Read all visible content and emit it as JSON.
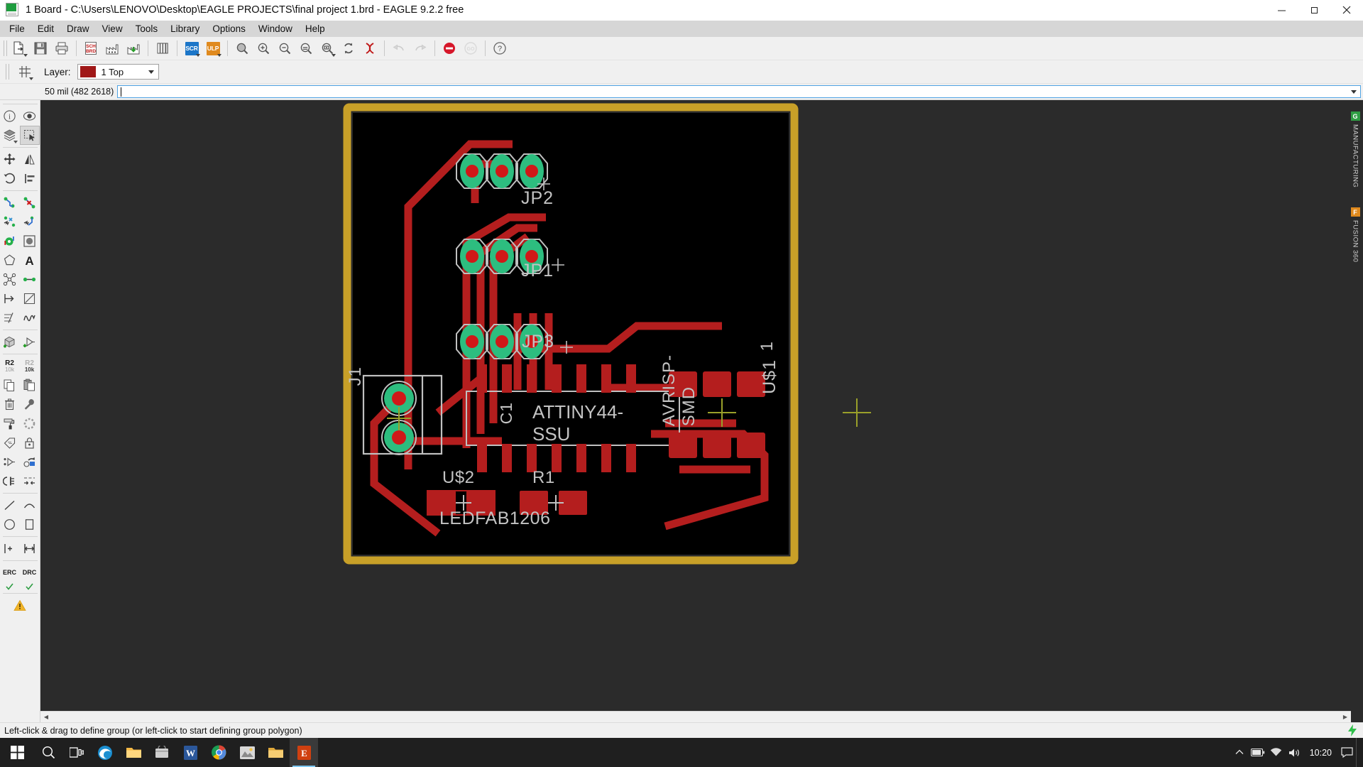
{
  "window": {
    "title": "1 Board - C:\\Users\\LENOVO\\Desktop\\EAGLE PROJECTS\\final project 1.brd - EAGLE 9.2.2 free",
    "app_icon": "brd-file-icon",
    "minimize_label": "Minimize",
    "maximize_label": "Restore",
    "close_label": "Close"
  },
  "menubar": {
    "items": [
      {
        "label": "File"
      },
      {
        "label": "Edit"
      },
      {
        "label": "Draw"
      },
      {
        "label": "View"
      },
      {
        "label": "Tools"
      },
      {
        "label": "Library"
      },
      {
        "label": "Options"
      },
      {
        "label": "Window"
      },
      {
        "label": "Help"
      }
    ]
  },
  "toolbar": {
    "buttons": [
      {
        "name": "open-file-button",
        "icon": "open-document-icon",
        "title": "Open",
        "dropdown": true,
        "disabled": false
      },
      {
        "name": "save-button",
        "icon": "floppy-save-icon",
        "title": "Save",
        "dropdown": false,
        "disabled": false
      },
      {
        "name": "print-button",
        "icon": "printer-icon",
        "title": "Print",
        "dropdown": false,
        "disabled": false
      },
      {
        "name": "switch-to-schematic-button",
        "icon": "sch-brd-switch-icon",
        "title": "Switch to Schematic",
        "dropdown": false,
        "disabled": false
      },
      {
        "name": "cam-processor-button",
        "icon": "factory-icon",
        "title": "CAM Processor",
        "dropdown": false,
        "disabled": false
      },
      {
        "name": "manufacturing-download-button",
        "icon": "factory-download-icon",
        "title": "Generate manufacturing data",
        "dropdown": false,
        "disabled": false
      },
      {
        "name": "library-manager-button",
        "icon": "books-icon",
        "title": "Library Manager",
        "dropdown": false,
        "disabled": false
      },
      {
        "name": "script-button",
        "icon": "scr-icon",
        "title": "Execute Script",
        "dropdown": true,
        "disabled": false,
        "badge": "SCR",
        "badge_color": "#1c76c8"
      },
      {
        "name": "ulp-button",
        "icon": "ulp-icon",
        "title": "Run ULP",
        "dropdown": true,
        "disabled": false,
        "badge": "ULP",
        "badge_color": "#e08a1e"
      },
      {
        "name": "zoom-fit-button",
        "icon": "zoom-fit-icon",
        "title": "Zoom to fit",
        "dropdown": false,
        "disabled": false
      },
      {
        "name": "zoom-in-button",
        "icon": "zoom-in-icon",
        "title": "Zoom in",
        "dropdown": false,
        "disabled": false
      },
      {
        "name": "zoom-out-button",
        "icon": "zoom-out-icon",
        "title": "Zoom out",
        "dropdown": false,
        "disabled": false
      },
      {
        "name": "zoom-previous-button",
        "icon": "zoom-previous-icon",
        "title": "Zoom previous",
        "dropdown": false,
        "disabled": false
      },
      {
        "name": "zoom-select-button",
        "icon": "zoom-select-icon",
        "title": "Zoom select",
        "dropdown": true,
        "disabled": false
      },
      {
        "name": "redraw-button",
        "icon": "refresh-icon",
        "title": "Redraw",
        "dropdown": false,
        "disabled": false
      },
      {
        "name": "autorouter-button",
        "icon": "ratsnest-x-icon",
        "title": "Ratsnest",
        "dropdown": false,
        "disabled": false
      },
      {
        "name": "undo-button",
        "icon": "undo-arrow-icon",
        "title": "Undo",
        "dropdown": false,
        "disabled": true
      },
      {
        "name": "redo-button",
        "icon": "redo-arrow-icon",
        "title": "Redo",
        "dropdown": false,
        "disabled": true
      },
      {
        "name": "stop-button",
        "icon": "stop-circle-icon",
        "title": "Stop",
        "dropdown": false,
        "disabled": false
      },
      {
        "name": "go-button",
        "icon": "go-circle-icon",
        "title": "Go",
        "dropdown": false,
        "disabled": true
      },
      {
        "name": "help-button",
        "icon": "question-mark-icon",
        "title": "Help",
        "dropdown": false,
        "disabled": false
      }
    ]
  },
  "layerbar": {
    "grid_button_name": "grid-button",
    "grid_icon": "grid-icon",
    "label": "Layer:",
    "selected_layer": "1 Top",
    "layer_color": "#a01818"
  },
  "commandbar": {
    "coordinate": "50 mil (482 2618)",
    "command_value": "",
    "command_placeholder": ""
  },
  "toolpalette": {
    "rows": [
      [
        {
          "name": "info-tool",
          "icon": "info-circle-icon",
          "active": false
        },
        {
          "name": "show-tool",
          "icon": "eye-icon",
          "active": false
        }
      ],
      [
        {
          "name": "display-layers-tool",
          "icon": "layers-stack-icon",
          "active": false,
          "dropdown": true
        },
        {
          "name": "group-tool",
          "icon": "marquee-select-icon",
          "active": true
        }
      ],
      [
        {
          "name": "move-tool",
          "icon": "move-arrows-icon",
          "active": false
        },
        {
          "name": "mirror-tool",
          "icon": "mirror-icon",
          "active": false
        }
      ],
      [
        {
          "name": "rotate-tool",
          "icon": "rotate-arrow-icon",
          "active": false
        },
        {
          "name": "align-tool",
          "icon": "align-left-icon",
          "active": false
        }
      ],
      [
        {
          "name": "route-tool",
          "icon": "route-wire-icon",
          "active": false
        },
        {
          "name": "ripup-tool",
          "icon": "ripup-x-icon",
          "active": false
        }
      ],
      [
        {
          "name": "split-tool",
          "icon": "split-net-icon",
          "active": false
        },
        {
          "name": "miter-tool",
          "icon": "miter-wire-icon",
          "active": false
        }
      ],
      [
        {
          "name": "via-tool",
          "icon": "via-pad-icon",
          "active": false
        },
        {
          "name": "hole-tool",
          "icon": "hole-icon",
          "active": false
        }
      ],
      [
        {
          "name": "polygon-tool",
          "icon": "polygon-icon",
          "active": false
        },
        {
          "name": "text-tool",
          "icon": "text-a-icon",
          "active": false
        }
      ],
      [
        {
          "name": "ratsnest-tool",
          "icon": "ratsnest-star-icon",
          "active": false
        },
        {
          "name": "signal-tool",
          "icon": "signal-line-icon",
          "active": false
        }
      ],
      [
        {
          "name": "meander-tool",
          "icon": "length-arrow-icon",
          "active": false
        },
        {
          "name": "copy-area-tool",
          "icon": "corner-line-icon",
          "active": false
        }
      ],
      [
        {
          "name": "dimension-tool",
          "icon": "dimension-icon",
          "active": false
        },
        {
          "name": "wave-tool",
          "icon": "wave-icon",
          "active": false
        }
      ],
      [
        {
          "name": "add-part-tool",
          "icon": "add-package-icon",
          "active": false
        },
        {
          "name": "add-gate-tool",
          "icon": "add-gate-icon",
          "active": false
        }
      ],
      [
        {
          "name": "name-tool",
          "icon": "name-label-icon",
          "active": false,
          "text_top": "R2",
          "text_bottom": "10k"
        },
        {
          "name": "value-tool",
          "icon": "value-label-icon",
          "active": false,
          "text_top": "R2",
          "text_bottom": "10k",
          "gray": true
        }
      ],
      [
        {
          "name": "copy-tool",
          "icon": "copy-pages-icon",
          "active": false
        },
        {
          "name": "paste-tool",
          "icon": "paste-clipboard-icon",
          "active": false
        }
      ],
      [
        {
          "name": "delete-tool",
          "icon": "trash-icon",
          "active": false
        },
        {
          "name": "replace-tool",
          "icon": "wrench-icon",
          "active": false
        }
      ],
      [
        {
          "name": "paint-tool",
          "icon": "paint-roller-icon",
          "active": false
        },
        {
          "name": "optimize-tool",
          "icon": "dashed-circle-icon",
          "active": false
        }
      ],
      [
        {
          "name": "attribute-tool",
          "icon": "tag-icon",
          "active": false
        },
        {
          "name": "lock-tool",
          "icon": "padlock-icon",
          "active": false
        }
      ],
      [
        {
          "name": "invoke-tool",
          "icon": "plus-gate-icon",
          "active": false
        },
        {
          "name": "smash-tool",
          "icon": "smash-icon",
          "active": false
        }
      ],
      [
        {
          "name": "pinswap-tool",
          "icon": "pinswap-icon",
          "active": false
        },
        {
          "name": "clearance-tool",
          "icon": "clearance-arrows-icon",
          "active": false
        }
      ],
      [
        {
          "name": "line-tool",
          "icon": "line-icon",
          "active": false
        },
        {
          "name": "arc-tool",
          "icon": "arc-icon",
          "active": false
        }
      ],
      [
        {
          "name": "circle-tool",
          "icon": "circle-icon",
          "active": false
        },
        {
          "name": "rect-tool",
          "icon": "rectangle-icon",
          "active": false
        }
      ],
      [
        {
          "name": "mark-tool",
          "icon": "mark-cross-icon",
          "active": false
        },
        {
          "name": "measure-tool",
          "icon": "measure-arrows-icon",
          "active": false
        }
      ]
    ],
    "erc": {
      "name": "erc-button",
      "label": "ERC",
      "status_icon": "green-check-icon"
    },
    "drc": {
      "name": "drc-button",
      "label": "DRC",
      "status_icon": "green-check-icon"
    },
    "warning": {
      "name": "warning-button",
      "icon": "warning-triangle-icon"
    }
  },
  "canvas": {
    "background": "#2b2b2b",
    "board_outline_color": "#c8a028",
    "board_fill": "#000000",
    "trace_color": "#b41e1e",
    "pad_color": "#2dbd7f",
    "drill_color": "#d01818",
    "silk_color": "#c8c8c8",
    "labels": [
      {
        "text": "JP2",
        "name": "board-label-jp2"
      },
      {
        "text": "JP1",
        "name": "board-label-jp1"
      },
      {
        "text": "JP3",
        "name": "board-label-jp3"
      },
      {
        "text": "J1",
        "name": "board-label-j1"
      },
      {
        "text": "C1",
        "name": "board-label-c1"
      },
      {
        "text": "ATTINY44-SSU",
        "name": "board-label-attiny44-ssu"
      },
      {
        "text": "AVRISP-SMD",
        "name": "board-label-avrisp-smd"
      },
      {
        "text": "U$1",
        "name": "board-label-u1"
      },
      {
        "text": "1",
        "name": "board-label-pin1"
      },
      {
        "text": "U$2",
        "name": "board-label-u2"
      },
      {
        "text": "R1",
        "name": "board-label-r1"
      },
      {
        "text": "LEDFAB1206",
        "name": "board-label-ledfab1206"
      }
    ]
  },
  "right_tabs": [
    {
      "name": "manufacturing-tab",
      "label": "MANUFACTURING",
      "badge": "G",
      "badge_color": "#2f9e44"
    },
    {
      "name": "fusion360-tab",
      "label": "FUSION 360",
      "badge": "F",
      "badge_color": "#e08a1e"
    }
  ],
  "statusbar": {
    "message": "Left-click & drag to define group (or left-click to start defining group polygon)",
    "right_icon": "green-lightning-icon"
  },
  "taskbar": {
    "start_label": "Start",
    "apps": [
      {
        "name": "taskbar-search",
        "icon": "search-circle-icon",
        "active": false
      },
      {
        "name": "taskbar-taskview",
        "icon": "task-view-icon",
        "active": false
      },
      {
        "name": "taskbar-edge",
        "icon": "edge-browser-icon",
        "active": false
      },
      {
        "name": "taskbar-explorer",
        "icon": "folder-explorer-icon",
        "active": false
      },
      {
        "name": "taskbar-store",
        "icon": "store-icon",
        "active": false
      },
      {
        "name": "taskbar-word",
        "icon": "word-icon",
        "active": false
      },
      {
        "name": "taskbar-chrome",
        "icon": "chrome-icon",
        "active": false
      },
      {
        "name": "taskbar-photos",
        "icon": "photos-icon",
        "active": false
      },
      {
        "name": "taskbar-folder2",
        "icon": "folder-icon",
        "active": false
      },
      {
        "name": "taskbar-eagle",
        "icon": "eagle-icon",
        "active": true
      }
    ],
    "tray": [
      {
        "name": "tray-chevron-up",
        "icon": "chevron-up-icon"
      },
      {
        "name": "tray-battery",
        "icon": "battery-icon"
      },
      {
        "name": "tray-network",
        "icon": "wifi-icon"
      },
      {
        "name": "tray-volume",
        "icon": "speaker-icon"
      }
    ],
    "clock_time": "10:20",
    "notification_icon": "notification-icon"
  }
}
